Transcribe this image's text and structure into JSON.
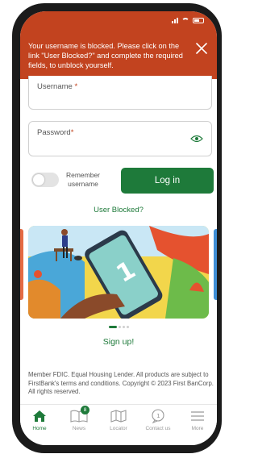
{
  "banner": {
    "message": "Your username is blocked. Please click on the link \"User Blocked?\" and complete the required fields, to unblock yourself.",
    "color": "#c2431f"
  },
  "form": {
    "username_label": "Username",
    "password_label": "Password",
    "required_mark": "*",
    "remember_label": "Remember username",
    "remember_on": false,
    "login_label": "Log in",
    "blocked_link": "User Blocked?"
  },
  "promo": {
    "slide_count": 4,
    "active_slide": 1,
    "signup_label": "Sign up!"
  },
  "footer": {
    "disclaimer": "Member FDIC. Equal Housing Lender. All products are subject to FirstBank's terms and conditions. Copyright © 2023 First BanCorp. All rights reserved."
  },
  "nav": {
    "items": [
      {
        "label": "Home",
        "icon": "home-icon",
        "active": true
      },
      {
        "label": "News",
        "icon": "news-icon",
        "badge": "8"
      },
      {
        "label": "Locator",
        "icon": "map-icon"
      },
      {
        "label": "Contact us",
        "icon": "contact-icon"
      },
      {
        "label": "More",
        "icon": "menu-icon"
      }
    ]
  },
  "theme": {
    "accent": "#1e7a3a",
    "alert": "#c2431f"
  }
}
